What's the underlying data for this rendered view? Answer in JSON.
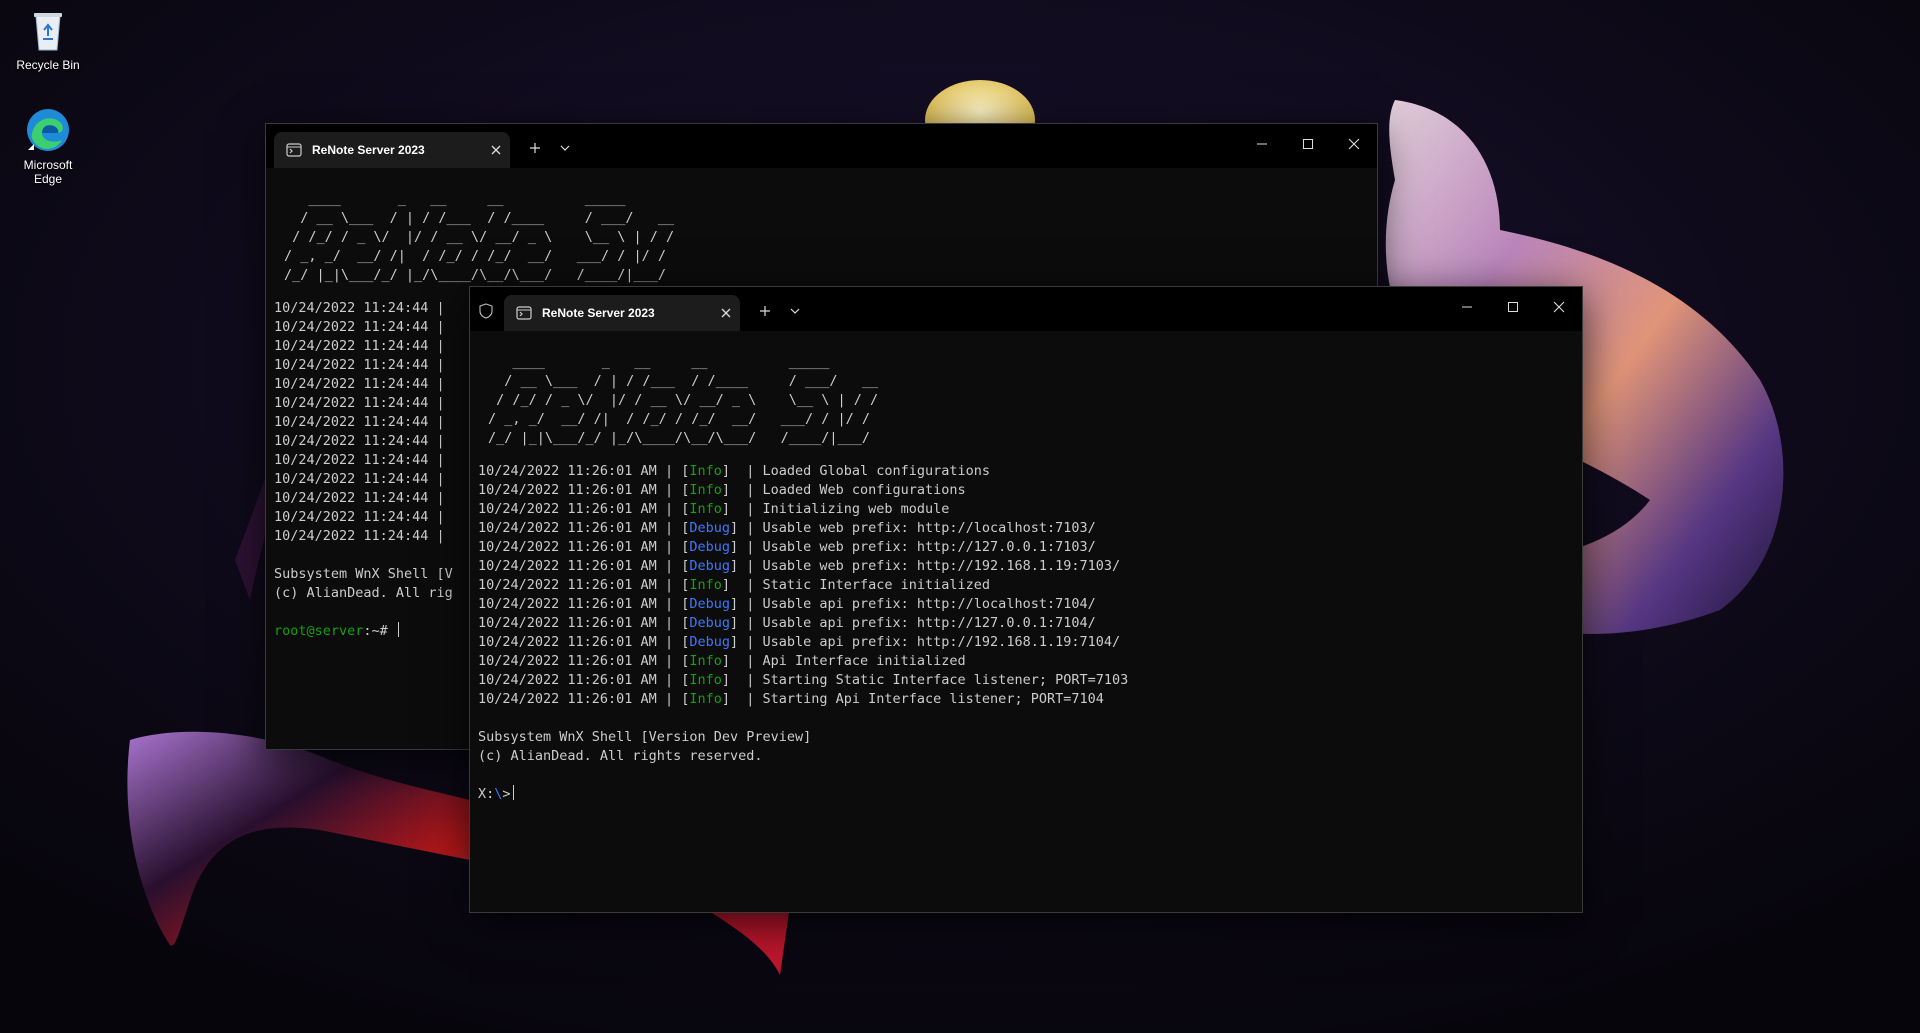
{
  "desktop": {
    "icons": [
      {
        "label": "Recycle Bin",
        "icon": "recycle-bin-icon"
      },
      {
        "label": "Microsoft Edge",
        "icon": "edge-icon"
      }
    ]
  },
  "window_back": {
    "tab_title": "ReNote Server 2023",
    "ascii_art": "   ____       _   __     __          _____\n  / __ \\___  / | / /___  / /____     / ___/   __\n / /_/ / _ \\/  |/ / __ \\/ __/ _ \\    \\__ \\ | / /\n/ _, _/  __/ /|  / /_/ / /_/  __/   ___/ / |/ /\n/_/ |_|\\___/_/ |_/\\____/\\__/\\___/   /____/|___/",
    "log_lines": [
      "10/24/2022 11:24:44 |",
      "10/24/2022 11:24:44 |",
      "10/24/2022 11:24:44 |",
      "10/24/2022 11:24:44 |",
      "10/24/2022 11:24:44 |",
      "10/24/2022 11:24:44 |",
      "10/24/2022 11:24:44 |",
      "10/24/2022 11:24:44 |",
      "10/24/2022 11:24:44 |",
      "10/24/2022 11:24:44 |",
      "10/24/2022 11:24:44 |",
      "10/24/2022 11:24:44 |",
      "10/24/2022 11:24:44 |"
    ],
    "banner_line1": "Subsystem WnX Shell [V",
    "banner_line2": "(c) AlianDead. All rig",
    "prompt_user": "root@server",
    "prompt_rest": ":~# "
  },
  "window_front": {
    "tab_title": "ReNote Server 2023",
    "ascii_art": "   ____       _   __     __          _____\n  / __ \\___  / | / /___  / /____     / ___/   __\n / /_/ / _ \\/  |/ / __ \\/ __/ _ \\    \\__ \\ | / /\n/ _, _/  __/ /|  / /_/ / /_/  __/   ___/ / |/ /\n/_/ |_|\\___/_/ |_/\\____/\\__/\\___/   /____/|___/",
    "log_lines": [
      {
        "ts": "10/24/2022 11:26:01 AM",
        "level": "Info",
        "msg": "Loaded Global configurations"
      },
      {
        "ts": "10/24/2022 11:26:01 AM",
        "level": "Info",
        "msg": "Loaded Web configurations"
      },
      {
        "ts": "10/24/2022 11:26:01 AM",
        "level": "Info",
        "msg": "Initializing web module"
      },
      {
        "ts": "10/24/2022 11:26:01 AM",
        "level": "Debug",
        "msg": "Usable web prefix: http://localhost:7103/"
      },
      {
        "ts": "10/24/2022 11:26:01 AM",
        "level": "Debug",
        "msg": "Usable web prefix: http://127.0.0.1:7103/"
      },
      {
        "ts": "10/24/2022 11:26:01 AM",
        "level": "Debug",
        "msg": "Usable web prefix: http://192.168.1.19:7103/"
      },
      {
        "ts": "10/24/2022 11:26:01 AM",
        "level": "Info",
        "msg": "Static Interface initialized"
      },
      {
        "ts": "10/24/2022 11:26:01 AM",
        "level": "Debug",
        "msg": "Usable api prefix: http://localhost:7104/"
      },
      {
        "ts": "10/24/2022 11:26:01 AM",
        "level": "Debug",
        "msg": "Usable api prefix: http://127.0.0.1:7104/"
      },
      {
        "ts": "10/24/2022 11:26:01 AM",
        "level": "Debug",
        "msg": "Usable api prefix: http://192.168.1.19:7104/"
      },
      {
        "ts": "10/24/2022 11:26:01 AM",
        "level": "Info",
        "msg": "Api Interface initialized"
      },
      {
        "ts": "10/24/2022 11:26:01 AM",
        "level": "Info",
        "msg": "Starting Static Interface listener; PORT=7103"
      },
      {
        "ts": "10/24/2022 11:26:01 AM",
        "level": "Info",
        "msg": "Starting Api Interface listener; PORT=7104"
      }
    ],
    "banner_line1": "Subsystem WnX Shell [Version Dev Preview]",
    "banner_line2": "(c) AlianDead. All rights reserved.",
    "prompt_drive": "X:",
    "prompt_sep": "\\",
    "prompt_end": ">"
  },
  "colors": {
    "info": "#13a10e",
    "debug": "#3b78ff",
    "terminal_bg": "#0c0c0c",
    "text": "#cccccc"
  }
}
